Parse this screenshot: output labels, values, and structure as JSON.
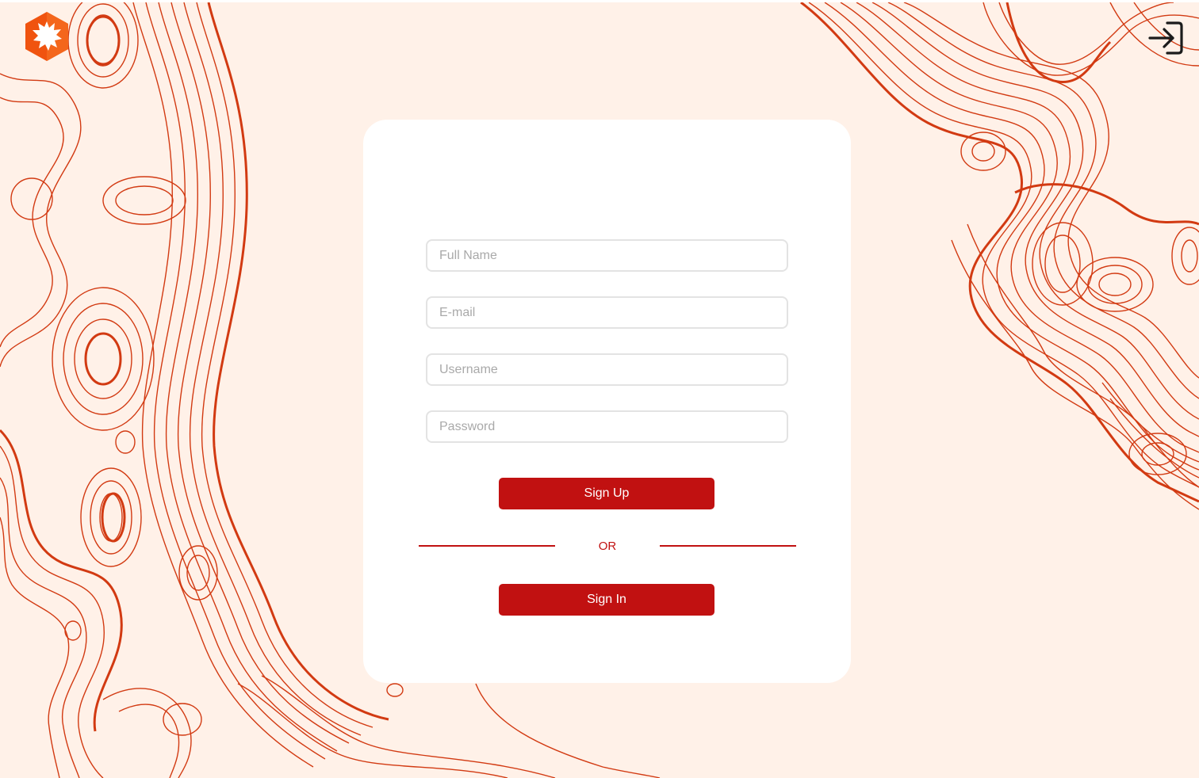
{
  "colors": {
    "background": "#fff1e8",
    "contour": "#d23a12",
    "card": "#ffffff",
    "accent": "#c11111",
    "field_border": "#e3e3e3",
    "placeholder": "#a9a9a9"
  },
  "header": {
    "logo_icon": "hexagon-sun-logo",
    "signin_icon": "login-arrow-icon"
  },
  "form": {
    "full_name": {
      "placeholder": "Full Name",
      "value": ""
    },
    "email": {
      "placeholder": "E-mail",
      "value": ""
    },
    "username": {
      "placeholder": "Username",
      "value": ""
    },
    "password": {
      "placeholder": "Password",
      "value": ""
    },
    "sign_up_label": "Sign Up",
    "divider_text": "OR",
    "sign_in_label": "Sign In"
  }
}
